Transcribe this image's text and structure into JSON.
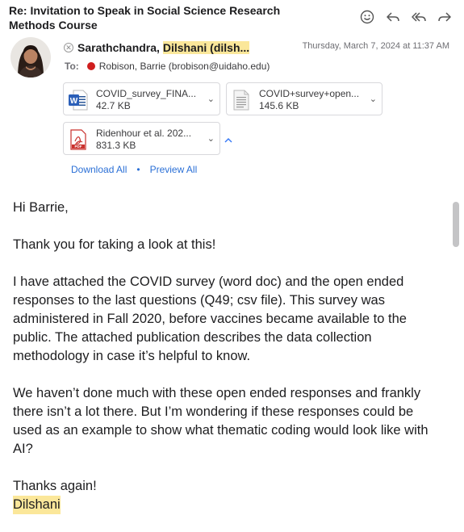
{
  "email": {
    "subject": "Re: Invitation to Speak in Social Science Research Methods Course",
    "from": {
      "name_part1": "Sarathchandra, ",
      "name_highlight": "Dilshani",
      "name_part2": " (dilsh..."
    },
    "date": "Thursday, March 7, 2024 at 11:37 AM",
    "to_label": "To:",
    "to_value": "Robison, Barrie (brobison@uidaho.edu)"
  },
  "attachments": [
    {
      "name": "COVID_survey_FINA...",
      "size": "42.7 KB",
      "icon": "word-doc-icon"
    },
    {
      "name": "COVID+survey+open...",
      "size": "145.6 KB",
      "icon": "csv-file-icon"
    },
    {
      "name": "Ridenhour et al. 202...",
      "size": "831.3 KB",
      "icon": "pdf-icon"
    }
  ],
  "links": {
    "download_all": "Download All",
    "separator": "•",
    "preview_all": "Preview All"
  },
  "body": {
    "greeting": "Hi Barrie,",
    "p1": "Thank you for taking a look at this!",
    "p2": "I have attached the COVID survey (word doc) and the open ended responses to the last questions (Q49; csv file). This survey was administered in Fall 2020, before vaccines became available to the public. The attached publication describes the data collection methodology in case it’s helpful to know.",
    "p3": "We haven’t done much with these open ended responses and frankly there isn’t a lot there. But I’m wondering if these responses could be used as an example to show what thematic coding would look like with AI?",
    "closing": "Thanks again!",
    "signature": "Dilshani"
  },
  "colors": {
    "highlight": "#fbe79a",
    "link": "#2a6fd6",
    "status_dot": "#cf1e1e"
  }
}
